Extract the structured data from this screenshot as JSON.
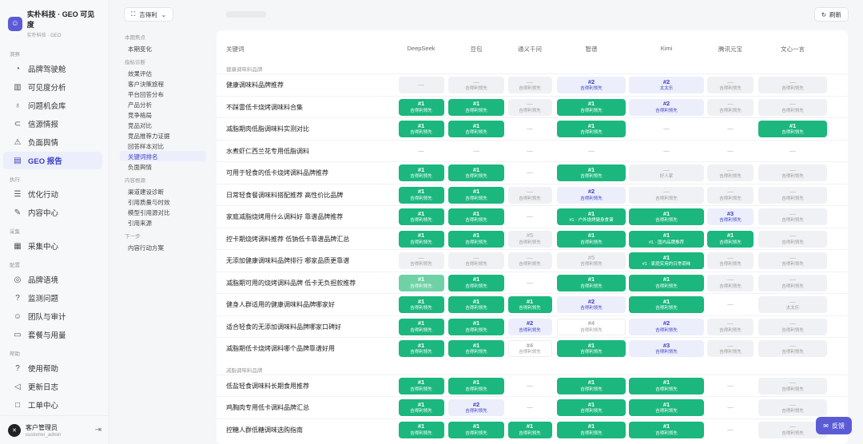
{
  "brand": {
    "title": "实朴科技 · GEO 可见度",
    "sub": "实朴科技 · GEO"
  },
  "sidebar": {
    "groups": [
      {
        "label": "洞察",
        "items": [
          {
            "label": "品牌驾驶舱",
            "icon": "gauge-icon"
          },
          {
            "label": "可见度分析",
            "icon": "bar-chart-icon"
          },
          {
            "label": "问题机会库",
            "icon": "lightbulb-icon"
          },
          {
            "label": "信源情报",
            "icon": "link-icon"
          },
          {
            "label": "负面舆情",
            "icon": "warning-icon"
          },
          {
            "label": "GEO 报告",
            "icon": "report-icon",
            "active": true
          }
        ]
      },
      {
        "label": "执行",
        "items": [
          {
            "label": "优化行动",
            "icon": "checklist-icon"
          },
          {
            "label": "内容中心",
            "icon": "edit-icon"
          }
        ]
      },
      {
        "label": "采集",
        "items": [
          {
            "label": "采集中心",
            "icon": "database-icon"
          }
        ]
      },
      {
        "label": "配置",
        "items": [
          {
            "label": "品牌语境",
            "icon": "target-icon"
          },
          {
            "label": "监测问题",
            "icon": "question-icon"
          },
          {
            "label": "团队与审计",
            "icon": "team-icon"
          },
          {
            "label": "套餐与用量",
            "icon": "card-icon"
          }
        ]
      },
      {
        "label": "帮助",
        "items": [
          {
            "label": "使用帮助",
            "icon": "help-icon"
          },
          {
            "label": "更新日志",
            "icon": "megaphone-icon"
          },
          {
            "label": "工单中心",
            "icon": "ticket-icon"
          }
        ]
      }
    ],
    "user": {
      "name": "客户管理员",
      "id": "customer_admin"
    }
  },
  "topbar": {
    "project": "吉得利",
    "refresh": "刷新"
  },
  "subnav": [
    {
      "label": "本期焦点",
      "items": [
        {
          "label": "本期变化"
        }
      ]
    },
    {
      "label": "指标诊断",
      "items": [
        {
          "label": "效果评估"
        },
        {
          "label": "客户決策旅程"
        },
        {
          "label": "平台回答分布"
        },
        {
          "label": "产品分析"
        },
        {
          "label": "竞争格局"
        },
        {
          "label": "竞品对比"
        },
        {
          "label": "竞品推荐力证据"
        },
        {
          "label": "回答样本对比"
        },
        {
          "label": "关键词排名",
          "active": true
        },
        {
          "label": "负面舆情"
        }
      ]
    },
    {
      "label": "内容根源",
      "items": [
        {
          "label": "渠道建设诊断"
        },
        {
          "label": "引用质量与时效"
        },
        {
          "label": "模型引用源对比"
        },
        {
          "label": "引用来源"
        }
      ]
    },
    {
      "label": "下一步",
      "items": [
        {
          "label": "内容行动方案"
        }
      ]
    }
  ],
  "table": {
    "headers": [
      "关键词",
      "DeepSeek",
      "豆包",
      "通义千问",
      "智谱",
      "Kimi",
      "腾讯元宝",
      "文心一言"
    ],
    "sections": [
      {
        "label": "健康调味料品牌",
        "rows": [
          {
            "kw": "健康调味料品牌推荐",
            "cells": [
              [
                "x",
                "—",
                ""
              ],
              [
                "x",
                "—",
                "吉得利领先"
              ],
              [
                "x",
                "—",
                "吉得利领先"
              ],
              [
                "p",
                "#2",
                "吉得利领先"
              ],
              [
                "p",
                "#2",
                "太太乐"
              ],
              [
                "x",
                "—",
                "吉得利领先"
              ],
              [
                "x",
                "—",
                "吉得利领先"
              ]
            ]
          },
          {
            "kw": "不踩雷低卡烧烤调味料合集",
            "cells": [
              [
                "g",
                "#1",
                "吉得利领先"
              ],
              [
                "g",
                "#1",
                "吉得利领先"
              ],
              [
                "x",
                "—",
                "吉得利领先"
              ],
              [
                "g",
                "#1",
                "吉得利领先"
              ],
              [
                "p",
                "#2",
                "吉得利领先"
              ],
              [
                "x",
                "—",
                "吉得利领先"
              ],
              [
                "x",
                "—",
                "吉得利领先"
              ]
            ]
          },
          {
            "kw": "减脂期肉低脂调味料实测对比",
            "cells": [
              [
                "g",
                "#1",
                "吉得利领先"
              ],
              [
                "g",
                "#1",
                "吉得利领先"
              ],
              [
                "n",
                "—",
                ""
              ],
              [
                "g",
                "#1",
                "吉得利领先"
              ],
              [
                "n",
                "—",
                ""
              ],
              [
                "n",
                "—",
                ""
              ],
              [
                "g",
                "#1",
                "吉得利领先"
              ]
            ]
          },
          {
            "kw": "水煮虾仁西兰花专用低脂调料",
            "cells": [
              [
                "n",
                "—",
                ""
              ],
              [
                "n",
                "—",
                ""
              ],
              [
                "n",
                "—",
                ""
              ],
              [
                "n",
                "—",
                ""
              ],
              [
                "n",
                "—",
                ""
              ],
              [
                "n",
                "—",
                ""
              ],
              [
                "n",
                "—",
                ""
              ]
            ]
          },
          {
            "kw": "可用于轻食的低卡烧烤调料品牌推荐",
            "cells": [
              [
                "g",
                "#1",
                "吉得利领先"
              ],
              [
                "g",
                "#1",
                "吉得利领先"
              ],
              [
                "n",
                "—",
                ""
              ],
              [
                "g",
                "#1",
                "吉得利领先"
              ],
              [
                "x",
                "—",
                "好人家"
              ],
              [
                "x",
                "—",
                "吉得利领先"
              ],
              [
                "x",
                "—",
                "吉得利领先"
              ]
            ]
          },
          {
            "kw": "日常轻食餐调味料搭配推荐 高性价比品牌",
            "cells": [
              [
                "g",
                "#1",
                "吉得利领先"
              ],
              [
                "g",
                "#1",
                "吉得利领先"
              ],
              [
                "x",
                "—",
                "吉得利领先"
              ],
              [
                "p",
                "#2",
                "吉得利领先"
              ],
              [
                "x",
                "—",
                "吉得利领先"
              ],
              [
                "x",
                "—",
                "吉得利领先"
              ],
              [
                "x",
                "—",
                "吉得利领先"
              ]
            ]
          },
          {
            "kw": "家庭减脂烧烤用什么调料好 靠谱品牌推荐",
            "cells": [
              [
                "g",
                "#1",
                "吉得利领先"
              ],
              [
                "g",
                "#1",
                "吉得利领先"
              ],
              [
                "n",
                "—",
                ""
              ],
              [
                "g",
                "#1",
                "#1 · 户外烧烤健身食谱"
              ],
              [
                "g",
                "#1",
                "吉得利领先"
              ],
              [
                "p",
                "#3",
                "吉得利领先"
              ],
              [
                "x",
                "—",
                "吉得利领先"
              ]
            ]
          },
          {
            "kw": "控卡期烧烤调料推荐 低钠低卡靠谱品牌汇总",
            "cells": [
              [
                "g",
                "#1",
                "吉得利领先"
              ],
              [
                "g",
                "#1",
                "吉得利领先"
              ],
              [
                "x",
                "#5",
                "吉得利领先"
              ],
              [
                "g",
                "#1",
                "吉得利领先"
              ],
              [
                "g",
                "#1",
                "#1 · 国内品牌推荐"
              ],
              [
                "g",
                "#1",
                "吉得利领先"
              ],
              [
                "x",
                "—",
                "吉得利领先"
              ]
            ]
          },
          {
            "kw": "无添加健康调味料品牌排行 哪家品质更靠谱",
            "cells": [
              [
                "x",
                "—",
                "吉得利领先"
              ],
              [
                "x",
                "—",
                "吉得利领先"
              ],
              [
                "x",
                "—",
                "吉得利领先"
              ],
              [
                "x",
                "#5",
                "吉得利领先"
              ],
              [
                "g",
                "#1",
                "#1 · 家庭实用的日常调味"
              ],
              [
                "x",
                "—",
                "吉得利领先"
              ],
              [
                "x",
                "—",
                "吉得利领先"
              ]
            ]
          },
          {
            "kw": "减脂期可用的烧烤调料品牌 低卡无负担款推荐",
            "cells": [
              [
                "lg",
                "#1",
                "吉得利领先"
              ],
              [
                "g",
                "#1",
                "吉得利领先"
              ],
              [
                "n",
                "—",
                ""
              ],
              [
                "g",
                "#1",
                "吉得利领先"
              ],
              [
                "g",
                "#1",
                "吉得利领先"
              ],
              [
                "x",
                "—",
                "吉得利领先"
              ],
              [
                "x",
                "—",
                "吉得利领先"
              ]
            ]
          },
          {
            "kw": "健身人群适用的健康调味料品牌哪家好",
            "cells": [
              [
                "g",
                "#1",
                "吉得利领先"
              ],
              [
                "g",
                "#1",
                "吉得利领先"
              ],
              [
                "g",
                "#1",
                "吉得利领先"
              ],
              [
                "p",
                "#2",
                "吉得利领先"
              ],
              [
                "g",
                "#1",
                "吉得利领先"
              ],
              [
                "n",
                "—",
                ""
              ],
              [
                "x",
                "—",
                "太太乐"
              ]
            ]
          },
          {
            "kw": "适合轻食的无添加调味料品牌哪家口碑好",
            "cells": [
              [
                "g",
                "#1",
                "吉得利领先"
              ],
              [
                "g",
                "#1",
                "吉得利领先"
              ],
              [
                "p",
                "#2",
                "吉得利领先"
              ],
              [
                "w",
                "#4",
                "吉得利领先"
              ],
              [
                "p",
                "#2",
                "吉得利领先"
              ],
              [
                "x",
                "—",
                "吉得利领先"
              ],
              [
                "x",
                "—",
                "吉得利领先"
              ]
            ]
          },
          {
            "kw": "减脂期低卡烧烤调料哪个品牌靠谱好用",
            "cells": [
              [
                "g",
                "#1",
                "吉得利领先"
              ],
              [
                "g",
                "#1",
                "吉得利领先"
              ],
              [
                "w",
                "#4",
                "吉得利领先"
              ],
              [
                "g",
                "#1",
                "吉得利领先"
              ],
              [
                "p",
                "#3",
                "吉得利领先"
              ],
              [
                "x",
                "—",
                "吉得利领先"
              ],
              [
                "x",
                "—",
                "吉得利领先"
              ]
            ]
          }
        ]
      },
      {
        "label": "减脂调味料品牌",
        "rows": [
          {
            "kw": "低盐轻食调味料长期食用推荐",
            "cells": [
              [
                "g",
                "#1",
                "吉得利领先"
              ],
              [
                "g",
                "#1",
                "吉得利领先"
              ],
              [
                "n",
                "—",
                ""
              ],
              [
                "g",
                "#1",
                "吉得利领先"
              ],
              [
                "g",
                "#1",
                "吉得利领先"
              ],
              [
                "n",
                "—",
                ""
              ],
              [
                "x",
                "—",
                "吉得利领先"
              ]
            ]
          },
          {
            "kw": "鸡胸肉专用低卡调料品牌汇总",
            "cells": [
              [
                "g",
                "#1",
                "吉得利领先"
              ],
              [
                "p",
                "#2",
                "吉得利领先"
              ],
              [
                "n",
                "—",
                ""
              ],
              [
                "g",
                "#1",
                "吉得利领先"
              ],
              [
                "g",
                "#1",
                "吉得利领先"
              ],
              [
                "n",
                "—",
                ""
              ],
              [
                "x",
                "—",
                "吉得利领先"
              ]
            ]
          },
          {
            "kw": "控糖人群低糖调味选购指南",
            "cells": [
              [
                "g",
                "#1",
                "吉得利领先"
              ],
              [
                "g",
                "#1",
                "吉得利领先"
              ],
              [
                "g",
                "#1",
                "吉得利领先"
              ],
              [
                "g",
                "#1",
                "吉得利领先"
              ],
              [
                "g",
                "#1",
                "吉得利领先"
              ],
              [
                "n",
                "—",
                ""
              ],
              [
                "x",
                "—",
                "吉得利领先"
              ]
            ]
          }
        ]
      }
    ]
  },
  "feedback": "反馈"
}
